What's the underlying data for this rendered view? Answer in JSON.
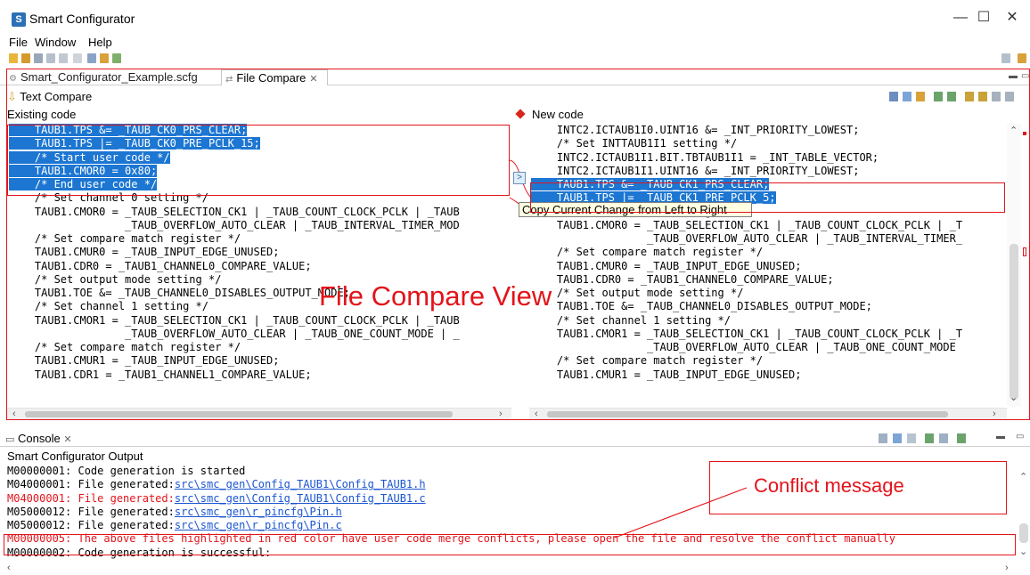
{
  "app": {
    "title": "Smart Configurator"
  },
  "window_controls": {
    "minimize": "—",
    "maximize": "☐",
    "close": "✕"
  },
  "menu": [
    "File",
    "Window",
    "Help"
  ],
  "editor_tabs": [
    {
      "label": "Smart_Configurator_Example.scfg",
      "active": false
    },
    {
      "label": "File Compare",
      "active": true
    }
  ],
  "compare": {
    "title": "Text Compare",
    "left_label": "Existing code",
    "right_label": "New code",
    "left_lines": [
      "    TAUB1.TPS &= _TAUB_CK0_PRS_CLEAR;",
      "    TAUB1.TPS |= _TAUB_CK0_PRE_PCLK_15;",
      "    /* Start user code */",
      "    TAUB1.CMOR0 = 0x80;",
      "    /* End user code */",
      "    /* Set channel 0 setting */",
      "    TAUB1.CMOR0 = _TAUB_SELECTION_CK1 | _TAUB_COUNT_CLOCK_PCLK | _TAUB",
      "                  _TAUB_OVERFLOW_AUTO_CLEAR | _TAUB_INTERVAL_TIMER_MOD",
      "    /* Set compare match register */",
      "    TAUB1.CMUR0 = _TAUB_INPUT_EDGE_UNUSED;",
      "    TAUB1.CDR0 = _TAUB1_CHANNEL0_COMPARE_VALUE;",
      "    /* Set output mode setting */",
      "    TAUB1.TOE &= _TAUB_CHANNEL0_DISABLES_OUTPUT_MODE;",
      "    /* Set channel 1 setting */",
      "    TAUB1.CMOR1 = _TAUB_SELECTION_CK1 | _TAUB_COUNT_CLOCK_PCLK | _TAUB",
      "                  _TAUB_OVERFLOW_AUTO_CLEAR | _TAUB_ONE_COUNT_MODE | _",
      "    /* Set compare match register */",
      "    TAUB1.CMUR1 = _TAUB_INPUT_EDGE_UNUSED;",
      "    TAUB1.CDR1 = _TAUB1_CHANNEL1_COMPARE_VALUE;"
    ],
    "right_lines": [
      "    INTC2.ICTAUB1I0.UINT16 &= _INT_PRIORITY_LOWEST;",
      "    /* Set INTTAUB1I1 setting */",
      "    INTC2.ICTAUB1I1.BIT.TBTAUB1I1 = _INT_TABLE_VECTOR;",
      "    INTC2.ICTAUB1I1.UINT16 &= _INT_PRIORITY_LOWEST;",
      "    TAUB1.TPS &= _TAUB_CK1_PRS_CLEAR;",
      "    TAUB1.TPS |= _TAUB_CK1_PRE_PCLK_5;",
      "    /* Set channel 0 setting */",
      "    TAUB1.CMOR0 = _TAUB_SELECTION_CK1 | _TAUB_COUNT_CLOCK_PCLK | _T",
      "                  _TAUB_OVERFLOW_AUTO_CLEAR | _TAUB_INTERVAL_TIMER_",
      "    /* Set compare match register */",
      "    TAUB1.CMUR0 = _TAUB_INPUT_EDGE_UNUSED;",
      "    TAUB1.CDR0 = _TAUB1_CHANNEL0_COMPARE_VALUE;",
      "    /* Set output mode setting */",
      "    TAUB1.TOE &= _TAUB_CHANNEL0_DISABLES_OUTPUT_MODE;",
      "    /* Set channel 1 setting */",
      "    TAUB1.CMOR1 = _TAUB_SELECTION_CK1 | _TAUB_COUNT_CLOCK_PCLK | _T",
      "                  _TAUB_OVERFLOW_AUTO_CLEAR | _TAUB_ONE_COUNT_MODE",
      "    /* Set compare match register */",
      "    TAUB1.CMUR1 = _TAUB_INPUT_EDGE_UNUSED;"
    ],
    "left_selected_count": 5,
    "right_selected_count": 2,
    "copy_button_label": ">",
    "tooltip": "Copy Current Change from Left to Right",
    "annotation": "File Compare View"
  },
  "console": {
    "tab_label": "Console",
    "title": "Smart Configurator Output",
    "lines": [
      {
        "prefix": "M00000001: Code generation is started",
        "link": "",
        "red": false
      },
      {
        "prefix": "M04000001: File generated:",
        "link": "src\\smc_gen\\Config_TAUB1\\Config_TAUB1.h",
        "red": false
      },
      {
        "prefix": "M04000001: File generated:",
        "link": "src\\smc_gen\\Config_TAUB1\\Config_TAUB1.c",
        "red": true
      },
      {
        "prefix": "M05000012: File generated:",
        "link": "src\\smc_gen\\r_pincfg\\Pin.h",
        "red": false
      },
      {
        "prefix": "M05000012: File generated:",
        "link": "src\\smc_gen\\r_pincfg\\Pin.c",
        "red": false
      },
      {
        "prefix": "M00000005: The above files highlighted in red color have user code merge conflicts, please open the file and resolve the conflict manually",
        "link": "",
        "red": true
      },
      {
        "prefix": "M00000002: Code generation is successful:",
        "link": "",
        "red": false
      }
    ],
    "annotation": "Conflict message"
  },
  "colors": {
    "accent_red": "#e3141b",
    "selection_blue": "#1c76d2",
    "link_blue": "#1a55d0"
  }
}
